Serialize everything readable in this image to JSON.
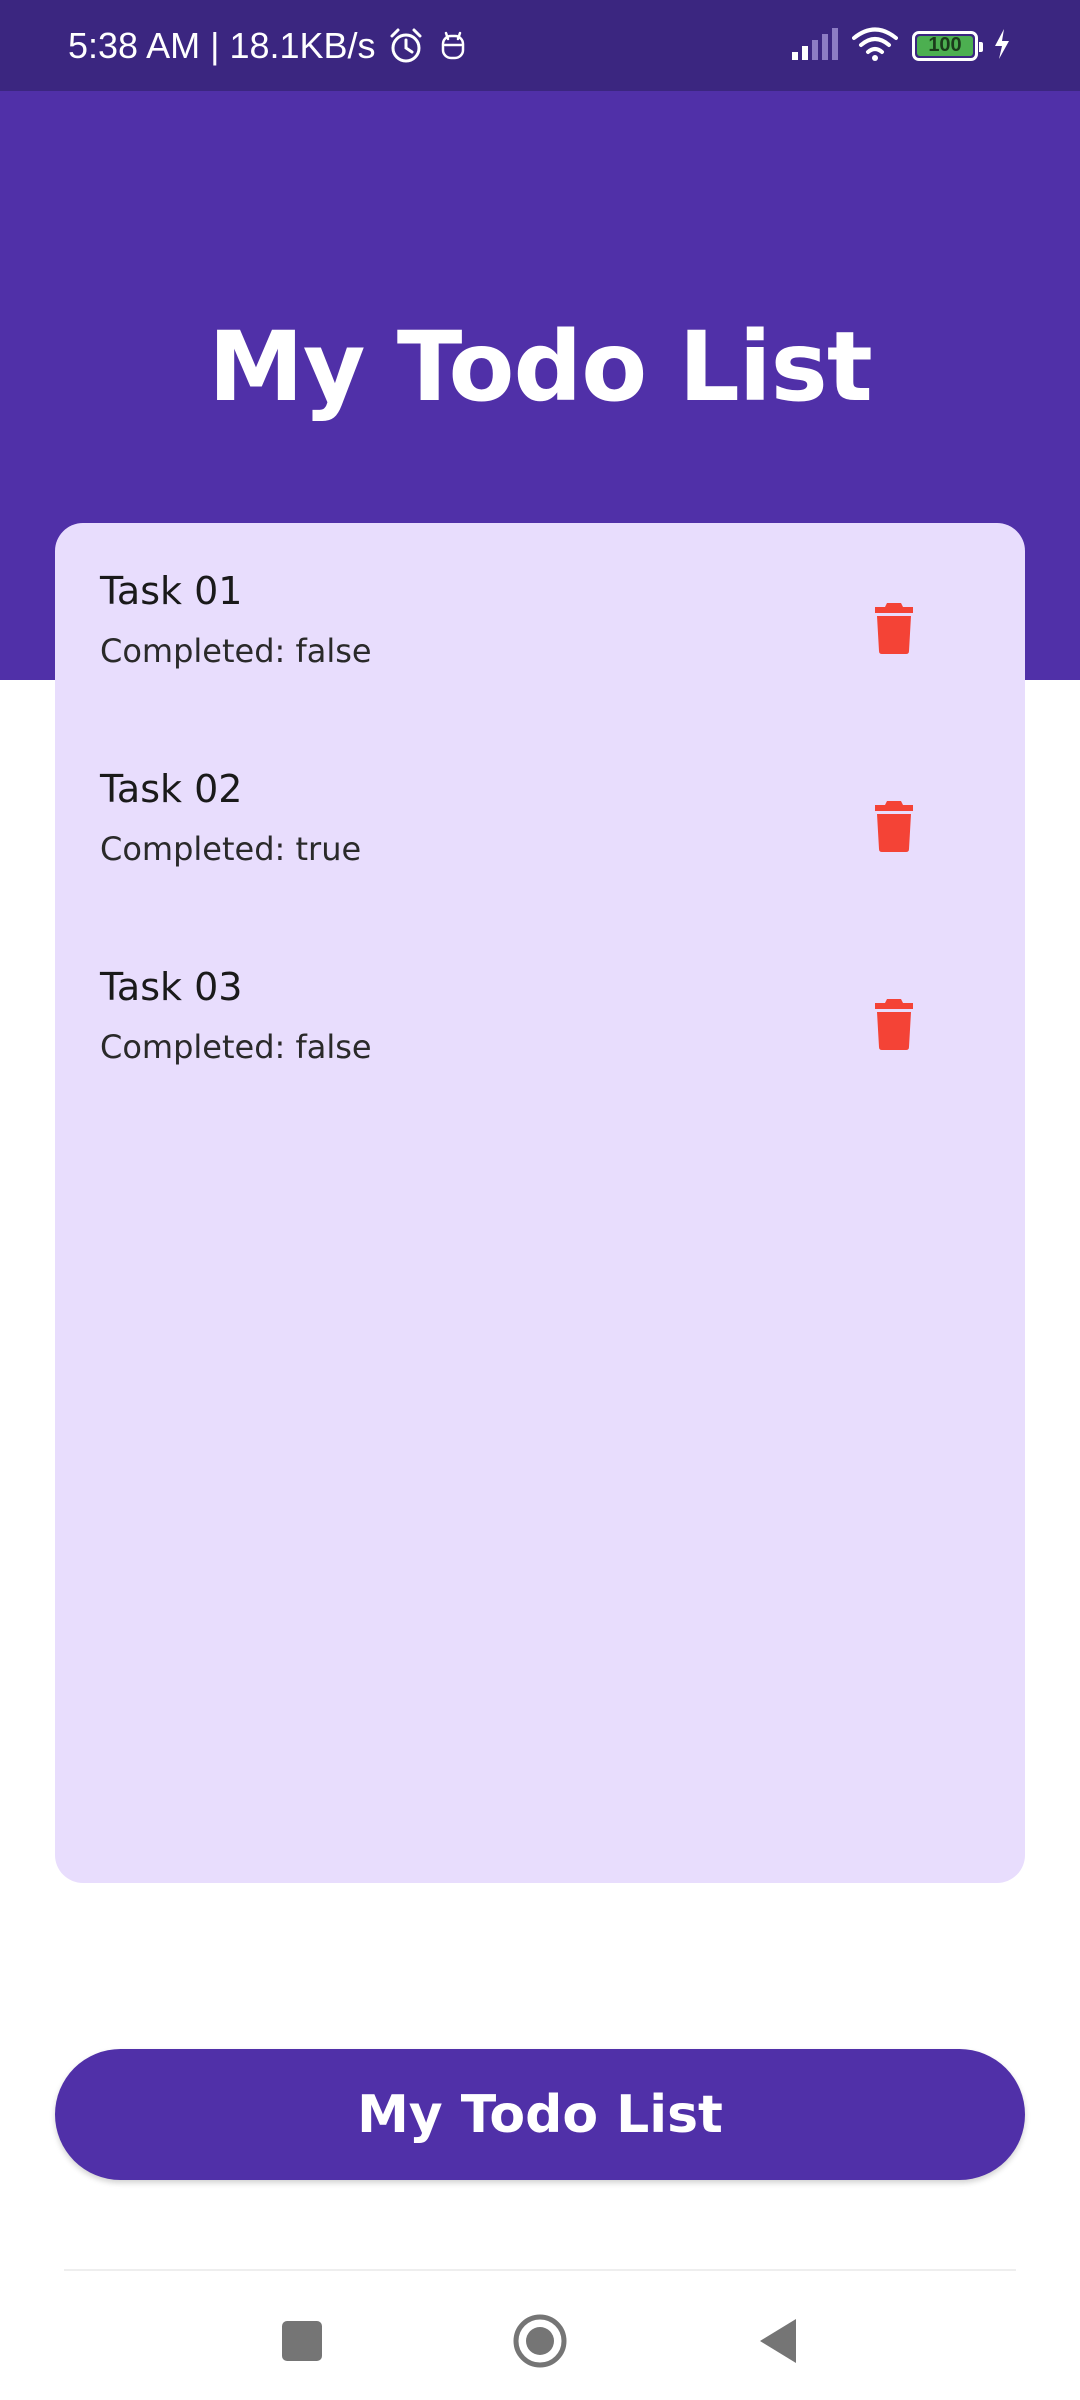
{
  "status_bar": {
    "time_speed": "5:38 AM | 18.1KB/s",
    "battery_level": "100",
    "battery_color": "#4caf50"
  },
  "header": {
    "title": "My Todo List",
    "background": "#5030a8"
  },
  "tasks": [
    {
      "title": "Task 01",
      "status": "Completed: false"
    },
    {
      "title": "Task 02",
      "status": "Completed: true"
    },
    {
      "title": "Task 03",
      "status": "Completed: false"
    }
  ],
  "card": {
    "background": "#e8ddfd"
  },
  "delete_icon_color": "#f44336",
  "primary_button": {
    "label": "My Todo List"
  },
  "icons": {
    "alarm": "alarm-icon",
    "notification": "notification-icon",
    "signal": "signal-icon",
    "wifi": "wifi-icon",
    "battery": "battery-icon",
    "charging": "charging-icon",
    "delete": "trash-icon",
    "recents": "square-icon",
    "home": "circle-icon",
    "back": "triangle-back-icon"
  }
}
